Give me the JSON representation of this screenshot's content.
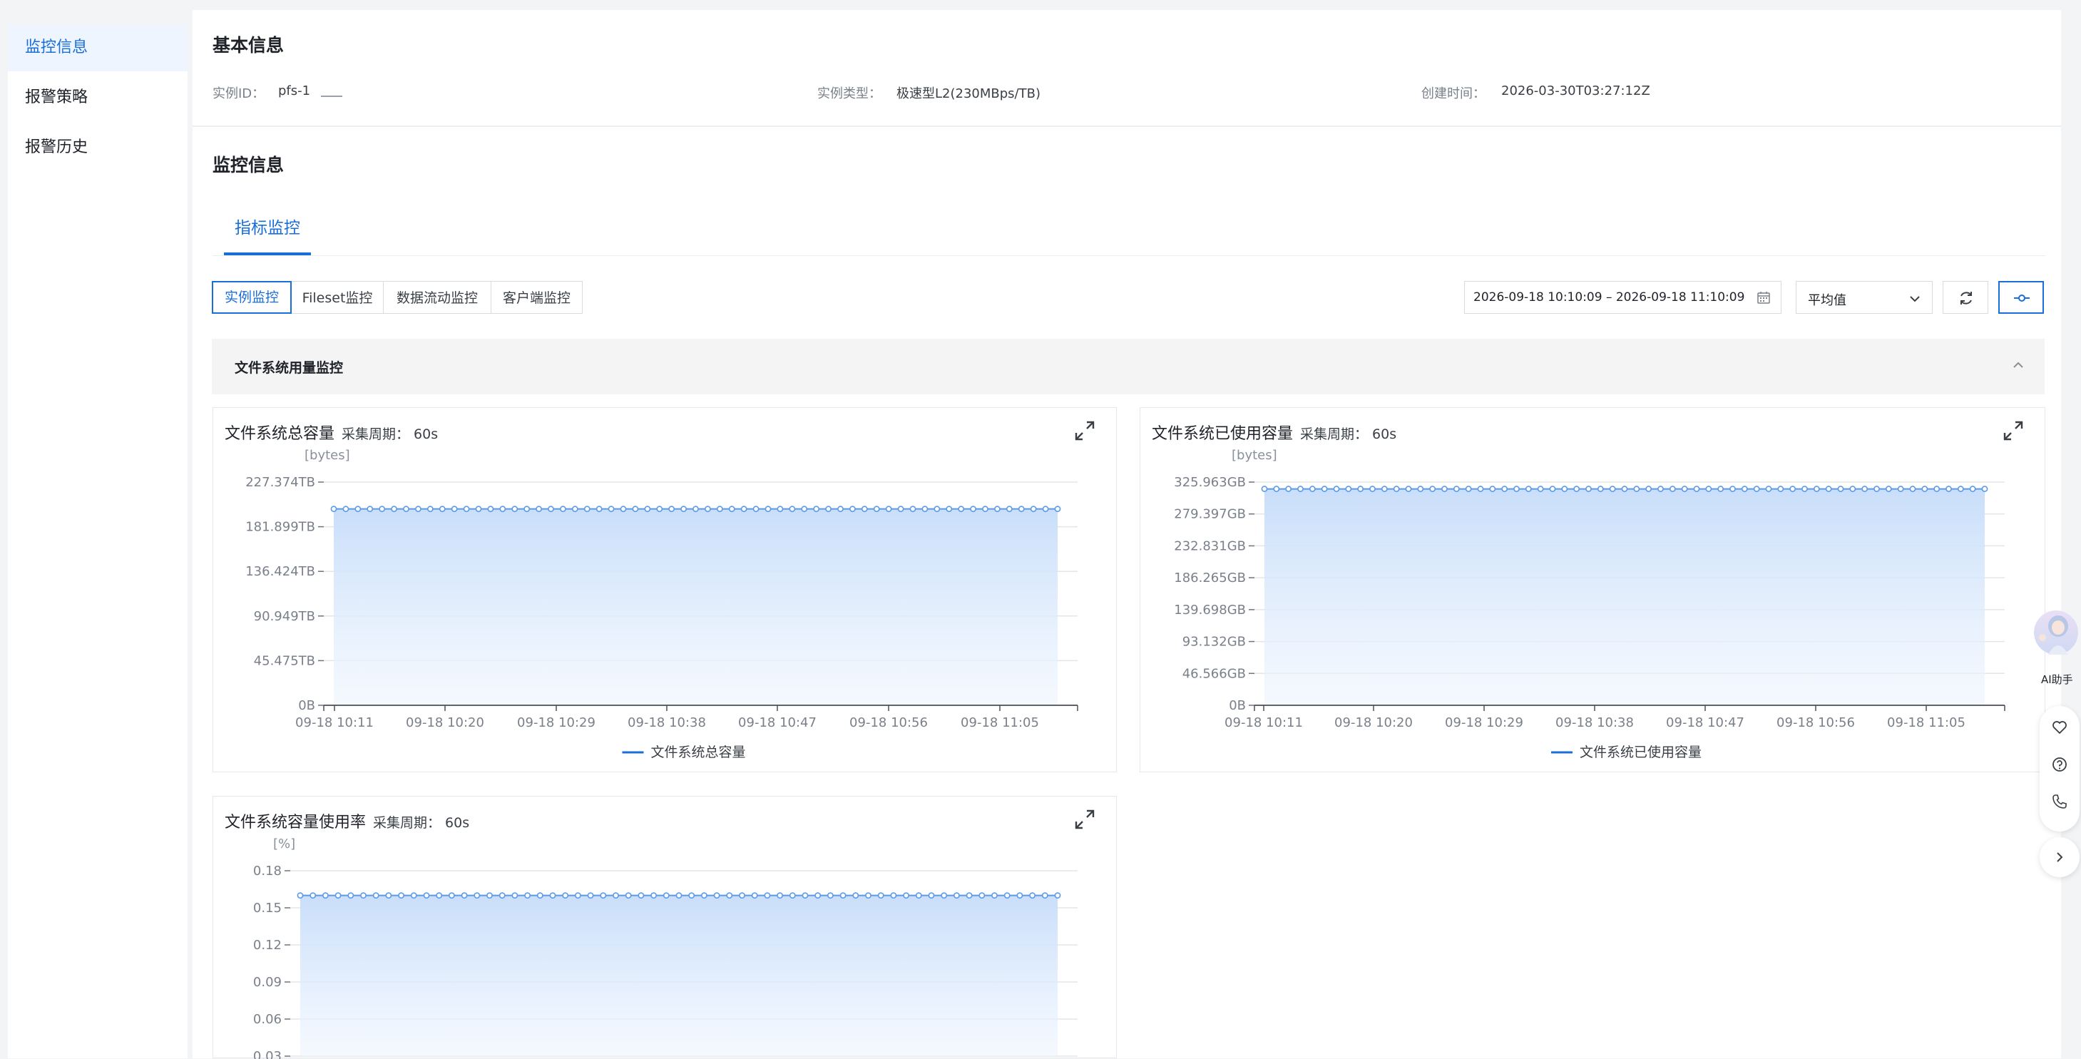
{
  "sidebar": {
    "items": [
      {
        "label": "监控信息",
        "active": true
      },
      {
        "label": "报警策略",
        "active": false
      },
      {
        "label": "报警历史",
        "active": false
      }
    ]
  },
  "basic_info": {
    "title": "基本信息",
    "instance_id_label": "实例ID：",
    "instance_id_value": "pfs-1",
    "instance_type_label": "实例类型：",
    "instance_type_value": "极速型L2(230MBps/TB)",
    "created_label": "创建时间：",
    "created_value": "2026-03-30T03:27:12Z"
  },
  "monitor": {
    "title": "监控信息",
    "tab": "指标监控",
    "segments": [
      "实例监控",
      "Fileset监控",
      "数据流动监控",
      "客户端监控"
    ],
    "time_range": "2026-09-18 10:10:09 – 2026-09-18 11:10:09",
    "aggregation": "平均值",
    "section_title": "文件系统用量监控",
    "accent_color": "#1a6ed8"
  },
  "ai_assistant_label": "AI助手",
  "icons": [
    "calendar-icon",
    "chevron-down-icon",
    "refresh-icon",
    "settings-slider-icon",
    "chevron-up-icon",
    "expand-icon",
    "heart-icon",
    "help-icon",
    "phone-icon",
    "chevron-right-icon"
  ],
  "chart_data": [
    {
      "type": "area",
      "title": "文件系统总容量",
      "period": "采集周期： 60s",
      "unit": "[bytes]",
      "y_ticks": [
        "227.374TB",
        "181.899TB",
        "136.424TB",
        "90.949TB",
        "45.475TB",
        "0B"
      ],
      "x_ticks": [
        "09-18 10:11",
        "09-18 10:20",
        "09-18 10:29",
        "09-18 10:38",
        "09-18 10:47",
        "09-18 10:56",
        "09-18 11:05"
      ],
      "ylim": [
        0,
        227.374
      ],
      "series": [
        {
          "name": "文件系统总容量",
          "value": 200,
          "points": 61
        }
      ],
      "legend": "bottom-center"
    },
    {
      "type": "area",
      "title": "文件系统已使用容量",
      "period": "采集周期： 60s",
      "unit": "[bytes]",
      "y_ticks": [
        "325.963GB",
        "279.397GB",
        "232.831GB",
        "186.265GB",
        "139.698GB",
        "93.132GB",
        "46.566GB",
        "0B"
      ],
      "x_ticks": [
        "09-18 10:11",
        "09-18 10:20",
        "09-18 10:29",
        "09-18 10:38",
        "09-18 10:47",
        "09-18 10:56",
        "09-18 11:05"
      ],
      "ylim": [
        0,
        325.963
      ],
      "series": [
        {
          "name": "文件系统已使用容量",
          "value": 316,
          "points": 61
        }
      ],
      "legend": "bottom-center"
    },
    {
      "type": "area",
      "title": "文件系统容量使用率",
      "period": "采集周期： 60s",
      "unit": "[%]",
      "y_ticks": [
        "0.18",
        "0.15",
        "0.12",
        "0.09",
        "0.06",
        "0.03"
      ],
      "ylim": [
        0.03,
        0.18
      ],
      "series": [
        {
          "name": "文件系统容量使用率",
          "value": 0.16,
          "points": 61
        }
      ]
    }
  ]
}
